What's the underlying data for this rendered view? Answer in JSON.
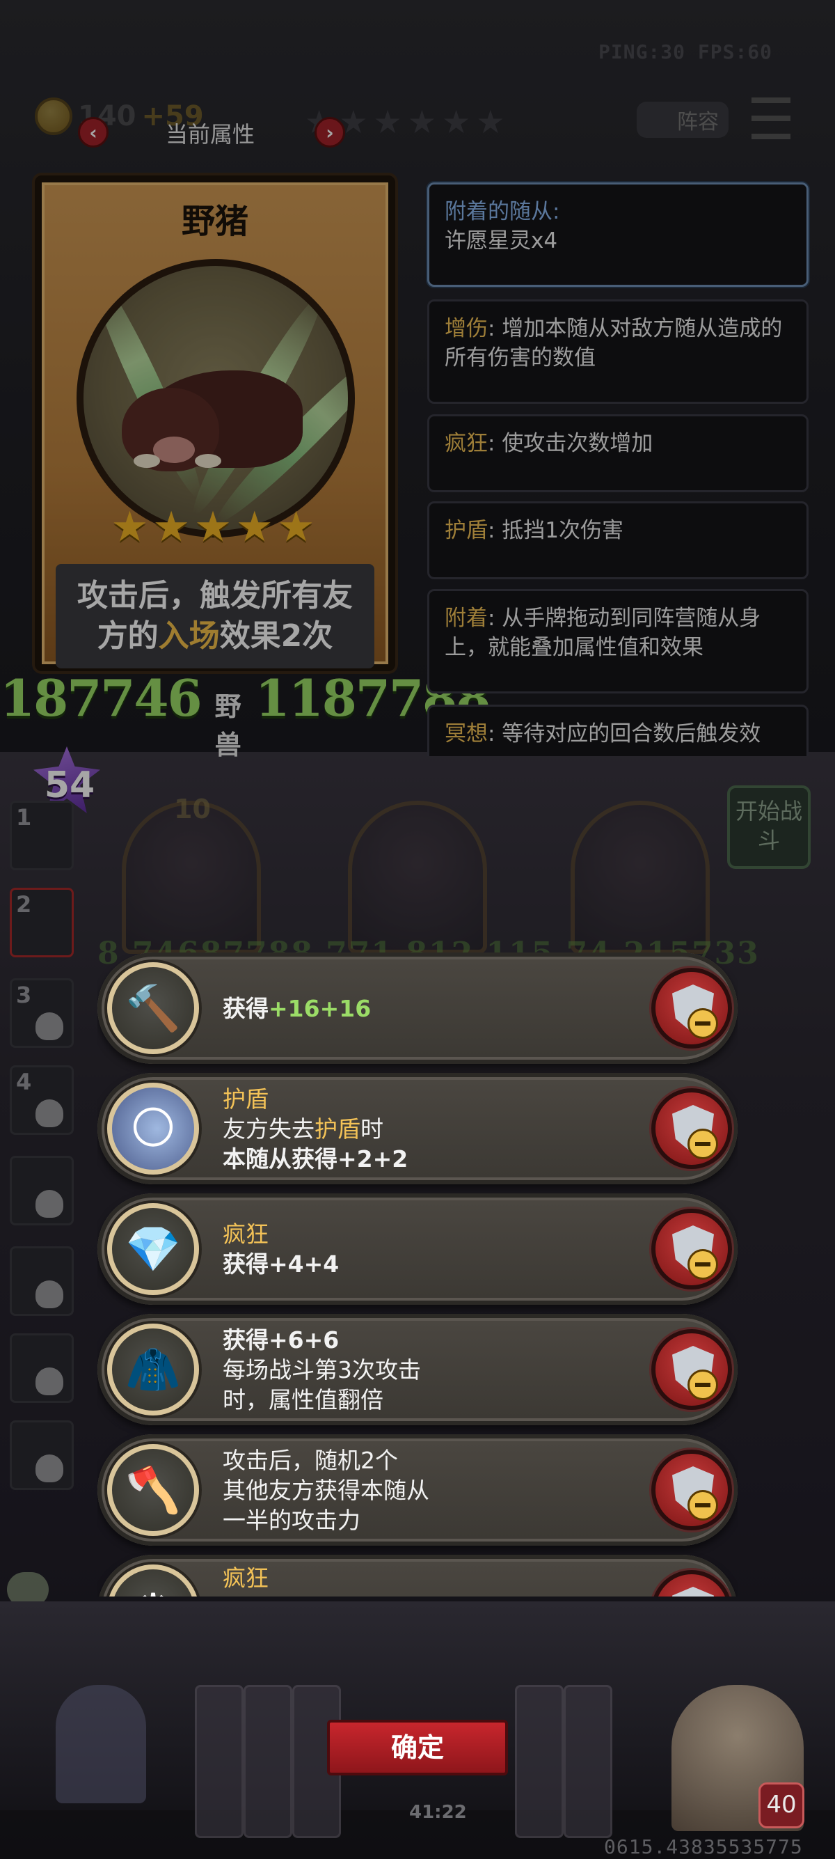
{
  "hud": {
    "ping": "PING:30",
    "fps": "FPS:60",
    "gold": "140",
    "gold_plus": "+59",
    "lineup_label": "阵容"
  },
  "attr_panel": {
    "title": "当前属性"
  },
  "card": {
    "name": "野猪",
    "stars": "★★★★★",
    "desc_pre": "攻击后，触发所有友方的",
    "desc_kw": "入场",
    "desc_post": "效果2次",
    "attack_num": "187746",
    "tribe": "野兽",
    "health_num": "1187788"
  },
  "keywords": {
    "attached_label": "附着的随从:",
    "attached_value": "许愿星灵x4",
    "items": [
      {
        "kw": "增伤",
        "text": ": 增加本随从对敌方随从造成的所有伤害的数值"
      },
      {
        "kw": "疯狂",
        "text": ": 使攻击次数增加"
      },
      {
        "kw": "护盾",
        "text": ": 抵挡1次伤害"
      },
      {
        "kw": "附着",
        "text": ": 从手牌拖动到同阵营随从身上，就能叠加属性值和效果"
      },
      {
        "kw": "冥想",
        "text": ": 等待对应的回合数后触发效"
      }
    ]
  },
  "board": {
    "gem_count": "54",
    "start_button": "开始战斗",
    "slot_numbers": [
      "1",
      "2",
      "3",
      "4"
    ],
    "card_cost": "10",
    "stats_row": "8 74687788   771   812   115 74 215733"
  },
  "effects": [
    {
      "icon": "hammer-icon",
      "title": "",
      "lines": [],
      "gain_pre": "获得",
      "gain_a": "+16",
      "gain_b": "+16",
      "gain_after": true
    },
    {
      "icon": "moon-shield-icon",
      "title": "护盾",
      "line1_pre": "友方失去",
      "line1_kw": "护盾",
      "line1_post": "时",
      "gain_pre": "本随从获得",
      "gain_a": "+2",
      "gain_b": "+2"
    },
    {
      "icon": "crystal-icon",
      "title": "疯狂",
      "gain_pre": "获得",
      "gain_a": "+4",
      "gain_b": "+4"
    },
    {
      "icon": "cloak-icon",
      "title": "",
      "gain_pre": "获得",
      "gain_a": "+6",
      "gain_b": "+6",
      "line2": "每场战斗第3次攻击",
      "line3": "时，属性值翻倍"
    },
    {
      "icon": "axe-icon",
      "title": "",
      "line1": "攻击后，随机2个",
      "line2": "其他友方获得本随从",
      "line3": "一半的攻击力"
    },
    {
      "icon": "gear-icon",
      "title": "疯狂"
    }
  ],
  "footer": {
    "confirm_label": "确定",
    "timer": "41:22",
    "version": "0615.43835535775",
    "hero_level": "40"
  },
  "colors": {
    "accent_gold": "#f3c257",
    "stat_green": "#9bdc67",
    "confirm_red": "#c8262d",
    "attached_blue": "#8bb7f0"
  }
}
